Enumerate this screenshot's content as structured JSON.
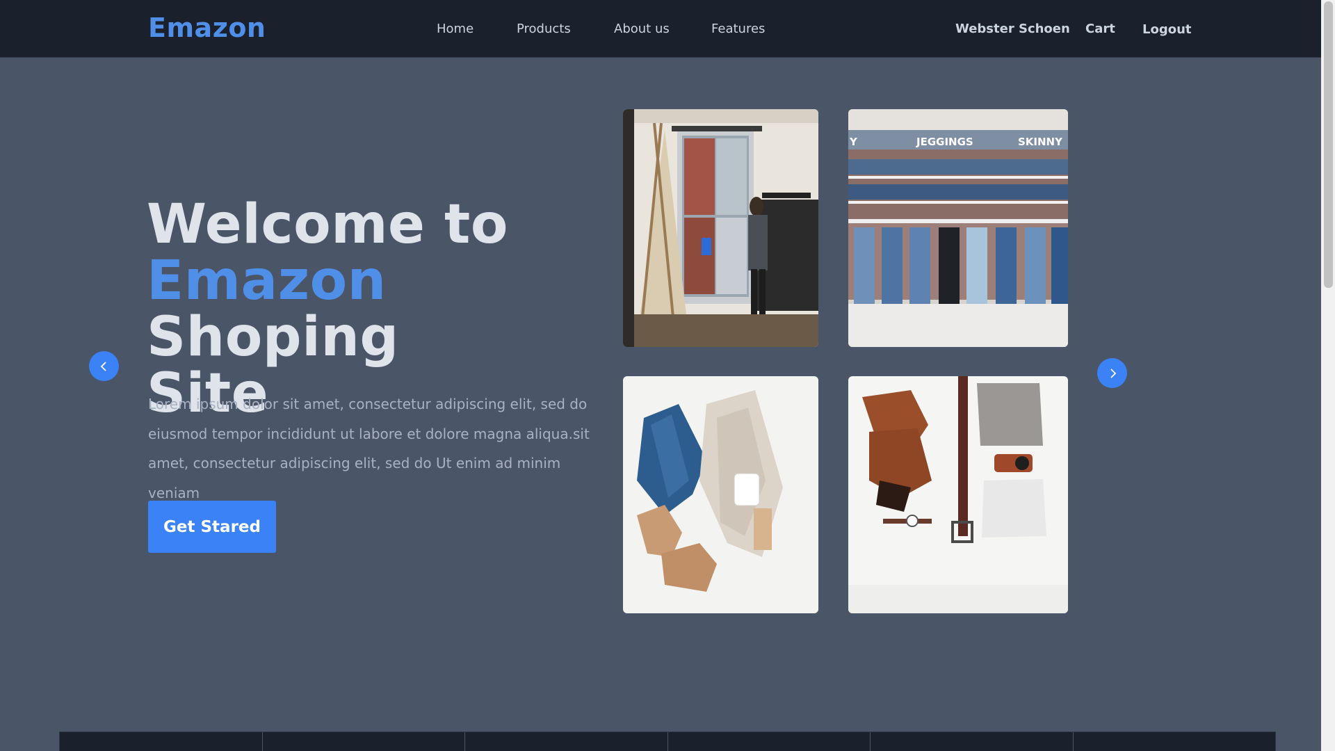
{
  "navbar": {
    "brand": "Emazon",
    "links": [
      "Home",
      "Products",
      "About us",
      "Features"
    ],
    "user_name": "Webster Schoen",
    "cart_label": "Cart",
    "logout_label": "Logout"
  },
  "hero": {
    "title_line1": "Welcome to",
    "title_accent": "Emazon",
    "title_rest": " Shoping",
    "title_line3": "Site",
    "description": "Lorem ipsum dolor sit amet, consectetur adipiscing elit, sed do eiusmod tempor incididunt ut labore et dolore magna aliqua.sit amet, consectetur adipiscing elit, sed do Ut enim ad minim veniam",
    "cta_label": "Get Stared"
  },
  "gallery": {
    "store_sign_left": "Y",
    "store_sign_mid": "JEGGINGS",
    "store_sign_right": "SKINNY"
  },
  "colors": {
    "navbar_bg": "#1a202c",
    "page_bg": "#4a5568",
    "accent": "#4f8fe8",
    "button": "#3b82f6"
  },
  "icons": {
    "prev": "chevron-left-icon",
    "next": "chevron-right-icon"
  }
}
